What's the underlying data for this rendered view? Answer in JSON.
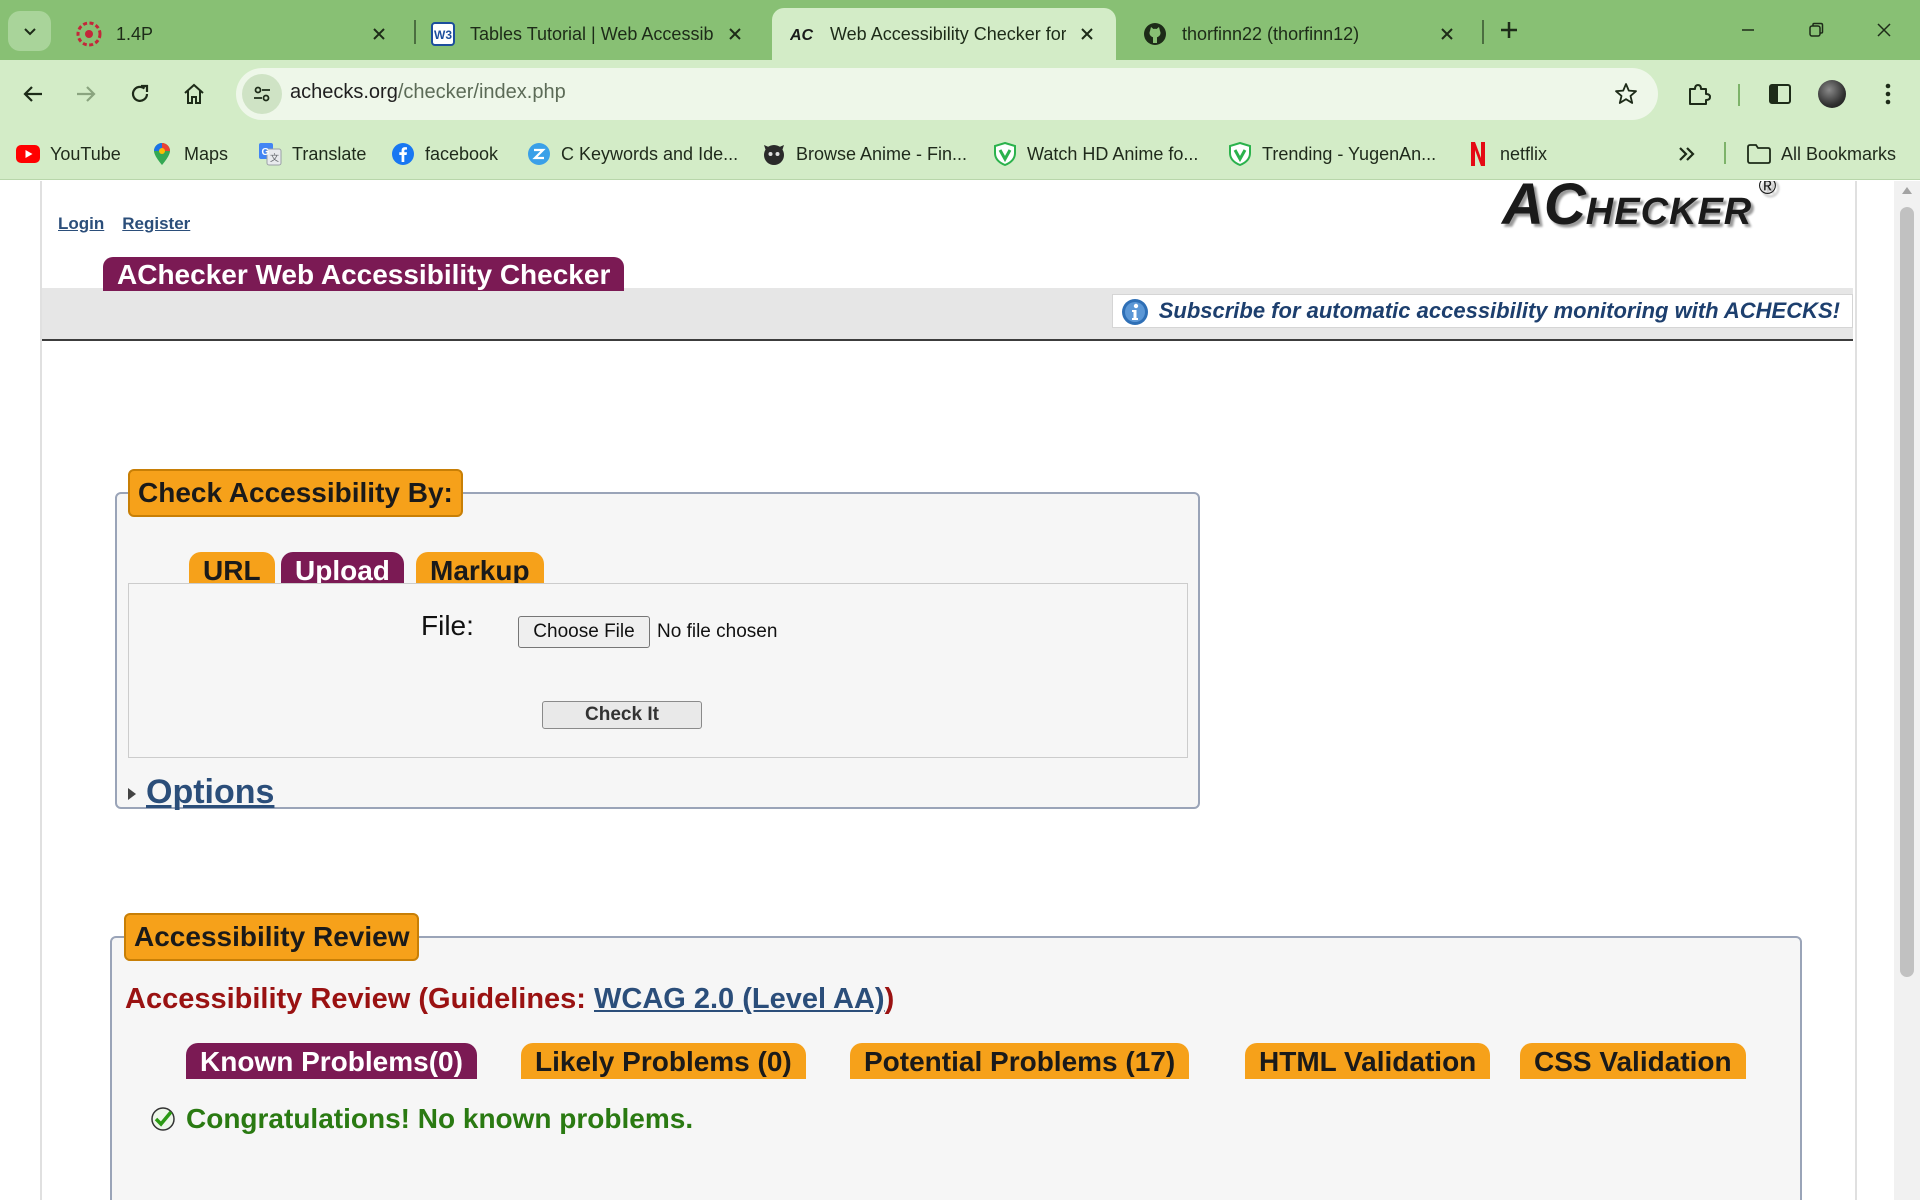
{
  "browser": {
    "tabs": [
      {
        "title": "1.4P",
        "icon": "asu-sunburst-icon",
        "active": false
      },
      {
        "title": "Tables Tutorial | Web Accessibility",
        "icon": "w3c-icon",
        "active": false
      },
      {
        "title": "Web Accessibility Checker for W",
        "icon": "achecker-icon",
        "active": true
      },
      {
        "title": "thorfinn22 (thorfinn12)",
        "icon": "github-icon",
        "active": false
      }
    ],
    "url_host": "achecks.org",
    "url_path": "/checker/index.php",
    "bookmarks": [
      {
        "label": "YouTube",
        "icon": "youtube-icon"
      },
      {
        "label": "Maps",
        "icon": "maps-pin-icon"
      },
      {
        "label": "Translate",
        "icon": "translate-icon"
      },
      {
        "label": "facebook",
        "icon": "facebook-icon"
      },
      {
        "label": "C Keywords and Ide...",
        "icon": "site-icon"
      },
      {
        "label": "Browse Anime - Fin...",
        "icon": "anime-site-icon"
      },
      {
        "label": "Watch HD Anime fo...",
        "icon": "shield-v-icon"
      },
      {
        "label": "Trending - YugenAn...",
        "icon": "shield-v-icon"
      },
      {
        "label": "netflix",
        "icon": "netflix-icon"
      }
    ],
    "all_bookmarks": "All Bookmarks",
    "colors": {
      "frame": "#88c074",
      "toolbar": "#d3ecc7"
    }
  },
  "page": {
    "login": "Login",
    "register": "Register",
    "logo": {
      "big": "AC",
      "small": "HECKER",
      "mark": "®"
    },
    "site_title": "AChecker Web Accessibility Checker",
    "subscribe": "Subscribe for automatic accessibility monitoring with ACHECKS!",
    "check_by": {
      "legend": "Check Accessibility By:",
      "tabs": [
        "URL",
        "Upload",
        "Markup"
      ],
      "active_tab": "Upload",
      "file_label": "File:",
      "choose_file": "Choose File",
      "no_file": "No file chosen",
      "check_button": "Check It",
      "options": "Options"
    },
    "review": {
      "legend": "Accessibility Review",
      "heading_prefix": "Accessibility Review (Guidelines: ",
      "guideline_link": "WCAG 2.0 (Level AA)",
      "heading_suffix": ")",
      "tabs": [
        "Known Problems(0)",
        "Likely Problems (0)",
        "Potential Problems (17)",
        "HTML Validation",
        "CSS Validation"
      ],
      "active_tab": "Known Problems(0)",
      "congrats": "Congratulations! No known problems."
    },
    "colors": {
      "accent_purple": "#7b1a54",
      "accent_orange": "#f6a11a",
      "link": "#2b4e7a",
      "heading_red": "#9a1212",
      "success_green": "#2a7a12"
    }
  }
}
